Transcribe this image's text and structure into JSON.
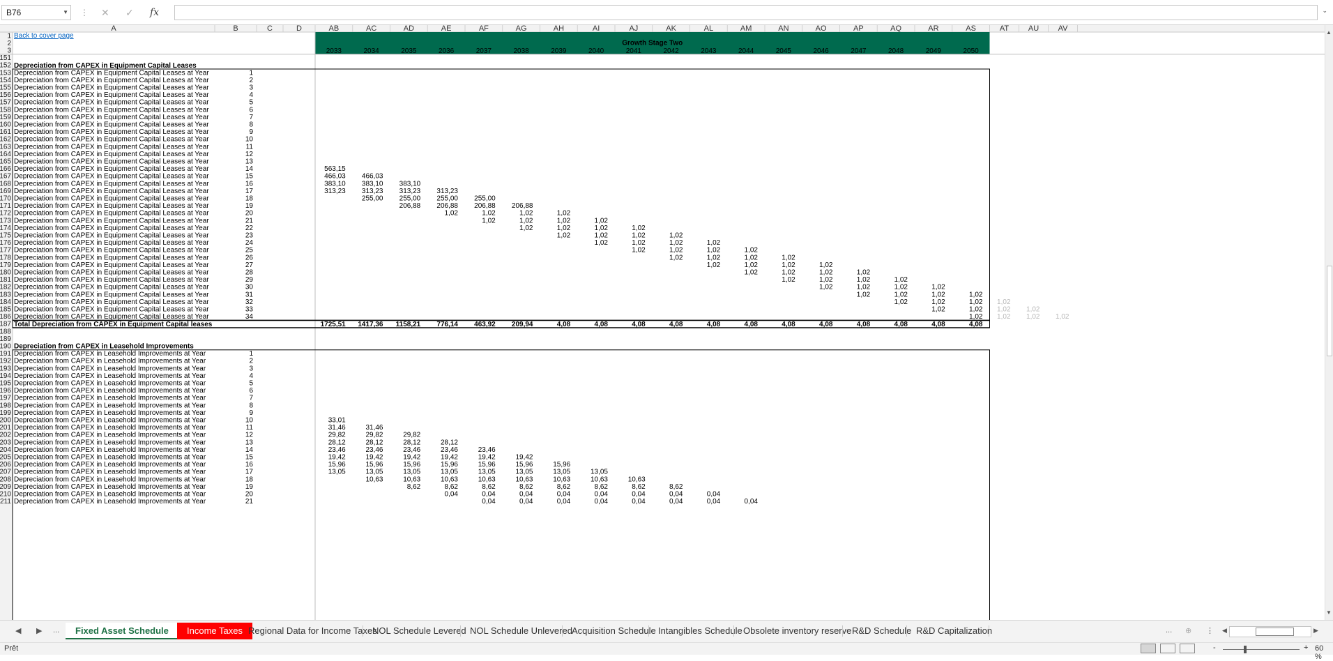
{
  "formula_bar": {
    "name_box": "B76",
    "formula": "",
    "cancel_icon": "close-icon",
    "enter_icon": "check-icon",
    "function_label": "fx"
  },
  "column_headers": [
    "A",
    "B",
    "C",
    "D",
    "AB",
    "AC",
    "AD",
    "AE",
    "AF",
    "AG",
    "AH",
    "AI",
    "AJ",
    "AK",
    "AL",
    "AM",
    "AN",
    "AO",
    "AP",
    "AQ",
    "AR",
    "AS",
    "AT",
    "AU",
    "AV"
  ],
  "header_block": {
    "link_text": "Back to cover page",
    "stage_title": "Growth Stage Two",
    "years": [
      "2033",
      "2034",
      "2035",
      "2036",
      "2037",
      "2038",
      "2039",
      "2040",
      "2041",
      "2042",
      "2043",
      "2044",
      "2045",
      "2046",
      "2047",
      "2048",
      "2049",
      "2050"
    ],
    "green": "#006a4e"
  },
  "section1": {
    "title": "Depreciation from CAPEX in Equipment Capital Leases",
    "row_label": "Depreciation from CAPEX in Equipment Capital Leases at Year",
    "total_label": "Total Depreciation from CAPEX in Equipment Capital leases",
    "totals": [
      "1725,51",
      "1417,36",
      "1158,21",
      "776,14",
      "463,92",
      "209,94",
      "4,08",
      "4,08",
      "4,08",
      "4,08",
      "4,08",
      "4,08",
      "4,08",
      "4,08",
      "4,08",
      "4,08",
      "4,08",
      "4,08"
    ]
  },
  "section2": {
    "title": "Depreciation from CAPEX in Leasehold Improvements",
    "row_label": "Depreciation from CAPEX in Leasehold Improvements at Year"
  },
  "sheet_tabs": [
    {
      "label": "Fixed Asset Schedule",
      "state": "active"
    },
    {
      "label": "Income Taxes",
      "state": "red"
    },
    {
      "label": "Regional Data for Income Taxes",
      "state": "normal"
    },
    {
      "label": "NOL Schedule Levered",
      "state": "normal"
    },
    {
      "label": "NOL Schedule Unlevered",
      "state": "normal"
    },
    {
      "label": "Acquisition Schedule",
      "state": "normal"
    },
    {
      "label": "Intangibles Schedule",
      "state": "normal"
    },
    {
      "label": "Obsolete inventory reserve",
      "state": "normal"
    },
    {
      "label": "R&D Schedule",
      "state": "normal"
    },
    {
      "label": "R&D Capitalization",
      "state": "normal"
    }
  ],
  "tab_nav": {
    "prev": "◀",
    "next": "▶",
    "more": "...",
    "more_right": "..."
  },
  "status": {
    "ready": "Prêt",
    "zoom": "60 %",
    "zoom_minus": "-",
    "zoom_plus": "+"
  },
  "grid_rows": [
    {
      "num": "1",
      "cells": {}
    },
    {
      "num": "2",
      "cells": {}
    },
    {
      "num": "3",
      "cells": {}
    },
    {
      "num": "151",
      "cells": {}
    },
    {
      "num": "152",
      "cells": {}
    },
    {
      "num": "153",
      "b": "1",
      "cells": {}
    },
    {
      "num": "154",
      "b": "2",
      "cells": {}
    },
    {
      "num": "155",
      "b": "3",
      "cells": {}
    },
    {
      "num": "156",
      "b": "4",
      "cells": {}
    },
    {
      "num": "157",
      "b": "5",
      "cells": {}
    },
    {
      "num": "158",
      "b": "6",
      "cells": {}
    },
    {
      "num": "159",
      "b": "7",
      "cells": {}
    },
    {
      "num": "160",
      "b": "8",
      "cells": {}
    },
    {
      "num": "161",
      "b": "9",
      "cells": {}
    },
    {
      "num": "162",
      "b": "10",
      "cells": {}
    },
    {
      "num": "163",
      "b": "11",
      "cells": {}
    },
    {
      "num": "164",
      "b": "12",
      "cells": {}
    },
    {
      "num": "165",
      "b": "13",
      "cells": {}
    },
    {
      "num": "166",
      "b": "14",
      "cells": {
        "0": "563,15"
      }
    },
    {
      "num": "167",
      "b": "15",
      "cells": {
        "0": "466,03",
        "1": "466,03"
      }
    },
    {
      "num": "168",
      "b": "16",
      "cells": {
        "0": "383,10",
        "1": "383,10",
        "2": "383,10"
      }
    },
    {
      "num": "169",
      "b": "17",
      "cells": {
        "0": "313,23",
        "1": "313,23",
        "2": "313,23",
        "3": "313,23"
      }
    },
    {
      "num": "170",
      "b": "18",
      "cells": {
        "1": "255,00",
        "2": "255,00",
        "3": "255,00",
        "4": "255,00"
      }
    },
    {
      "num": "171",
      "b": "19",
      "cells": {
        "2": "206,88",
        "3": "206,88",
        "4": "206,88",
        "5": "206,88"
      }
    },
    {
      "num": "172",
      "b": "20",
      "cells": {
        "3": "1,02",
        "4": "1,02",
        "5": "1,02",
        "6": "1,02"
      }
    },
    {
      "num": "173",
      "b": "21",
      "cells": {
        "4": "1,02",
        "5": "1,02",
        "6": "1,02",
        "7": "1,02"
      }
    },
    {
      "num": "174",
      "b": "22",
      "cells": {
        "5": "1,02",
        "6": "1,02",
        "7": "1,02",
        "8": "1,02"
      }
    },
    {
      "num": "175",
      "b": "23",
      "cells": {
        "6": "1,02",
        "7": "1,02",
        "8": "1,02",
        "9": "1,02"
      }
    },
    {
      "num": "176",
      "b": "24",
      "cells": {
        "7": "1,02",
        "8": "1,02",
        "9": "1,02",
        "10": "1,02"
      }
    },
    {
      "num": "177",
      "b": "25",
      "cells": {
        "8": "1,02",
        "9": "1,02",
        "10": "1,02",
        "11": "1,02"
      }
    },
    {
      "num": "178",
      "b": "26",
      "cells": {
        "9": "1,02",
        "10": "1,02",
        "11": "1,02",
        "12": "1,02"
      }
    },
    {
      "num": "179",
      "b": "27",
      "cells": {
        "10": "1,02",
        "11": "1,02",
        "12": "1,02",
        "13": "1,02"
      }
    },
    {
      "num": "180",
      "b": "28",
      "cells": {
        "11": "1,02",
        "12": "1,02",
        "13": "1,02",
        "14": "1,02"
      }
    },
    {
      "num": "181",
      "b": "29",
      "cells": {
        "12": "1,02",
        "13": "1,02",
        "14": "1,02",
        "15": "1,02"
      }
    },
    {
      "num": "182",
      "b": "30",
      "cells": {
        "13": "1,02",
        "14": "1,02",
        "15": "1,02",
        "16": "1,02"
      }
    },
    {
      "num": "183",
      "b": "31",
      "cells": {
        "14": "1,02",
        "15": "1,02",
        "16": "1,02",
        "17": "1,02"
      }
    },
    {
      "num": "184",
      "b": "32",
      "cells": {
        "15": "1,02",
        "16": "1,02",
        "17": "1,02"
      },
      "grey": {
        "18": "1,02"
      }
    },
    {
      "num": "185",
      "b": "33",
      "cells": {
        "16": "1,02",
        "17": "1,02"
      },
      "grey": {
        "18": "1,02",
        "19": "1,02"
      }
    },
    {
      "num": "186",
      "b": "34",
      "cells": {
        "17": "1,02"
      },
      "grey": {
        "18": "1,02",
        "19": "1,02",
        "20": "1,02"
      }
    },
    {
      "num": "187",
      "cells": {}
    },
    {
      "num": "188",
      "cells": {}
    },
    {
      "num": "189",
      "cells": {}
    },
    {
      "num": "190",
      "cells": {}
    },
    {
      "num": "191",
      "b": "1",
      "cells": {}
    },
    {
      "num": "192",
      "b": "2",
      "cells": {}
    },
    {
      "num": "193",
      "b": "3",
      "cells": {}
    },
    {
      "num": "194",
      "b": "4",
      "cells": {}
    },
    {
      "num": "195",
      "b": "5",
      "cells": {}
    },
    {
      "num": "196",
      "b": "6",
      "cells": {}
    },
    {
      "num": "197",
      "b": "7",
      "cells": {}
    },
    {
      "num": "198",
      "b": "8",
      "cells": {}
    },
    {
      "num": "199",
      "b": "9",
      "cells": {}
    },
    {
      "num": "200",
      "b": "10",
      "cells": {
        "0": "33,01"
      }
    },
    {
      "num": "201",
      "b": "11",
      "cells": {
        "0": "31,46",
        "1": "31,46"
      }
    },
    {
      "num": "202",
      "b": "12",
      "cells": {
        "0": "29,82",
        "1": "29,82",
        "2": "29,82"
      }
    },
    {
      "num": "203",
      "b": "13",
      "cells": {
        "0": "28,12",
        "1": "28,12",
        "2": "28,12",
        "3": "28,12"
      }
    },
    {
      "num": "204",
      "b": "14",
      "cells": {
        "0": "23,46",
        "1": "23,46",
        "2": "23,46",
        "3": "23,46",
        "4": "23,46"
      }
    },
    {
      "num": "205",
      "b": "15",
      "cells": {
        "0": "19,42",
        "1": "19,42",
        "2": "19,42",
        "3": "19,42",
        "4": "19,42",
        "5": "19,42"
      }
    },
    {
      "num": "206",
      "b": "16",
      "cells": {
        "0": "15,96",
        "1": "15,96",
        "2": "15,96",
        "3": "15,96",
        "4": "15,96",
        "5": "15,96",
        "6": "15,96"
      }
    },
    {
      "num": "207",
      "b": "17",
      "cells": {
        "0": "13,05",
        "1": "13,05",
        "2": "13,05",
        "3": "13,05",
        "4": "13,05",
        "5": "13,05",
        "6": "13,05",
        "7": "13,05"
      }
    },
    {
      "num": "208",
      "b": "18",
      "cells": {
        "1": "10,63",
        "2": "10,63",
        "3": "10,63",
        "4": "10,63",
        "5": "10,63",
        "6": "10,63",
        "7": "10,63",
        "8": "10,63"
      }
    },
    {
      "num": "209",
      "b": "19",
      "cells": {
        "2": "8,62",
        "3": "8,62",
        "4": "8,62",
        "5": "8,62",
        "6": "8,62",
        "7": "8,62",
        "8": "8,62",
        "9": "8,62"
      }
    },
    {
      "num": "210",
      "b": "20",
      "cells": {
        "3": "0,04",
        "4": "0,04",
        "5": "0,04",
        "6": "0,04",
        "7": "0,04",
        "8": "0,04",
        "9": "0,04",
        "10": "0,04"
      }
    },
    {
      "num": "211",
      "b": "21",
      "cells": {
        "4": "0,04",
        "5": "0,04",
        "6": "0,04",
        "7": "0,04",
        "8": "0,04",
        "9": "0,04",
        "10": "0,04",
        "11": "0,04"
      }
    }
  ]
}
